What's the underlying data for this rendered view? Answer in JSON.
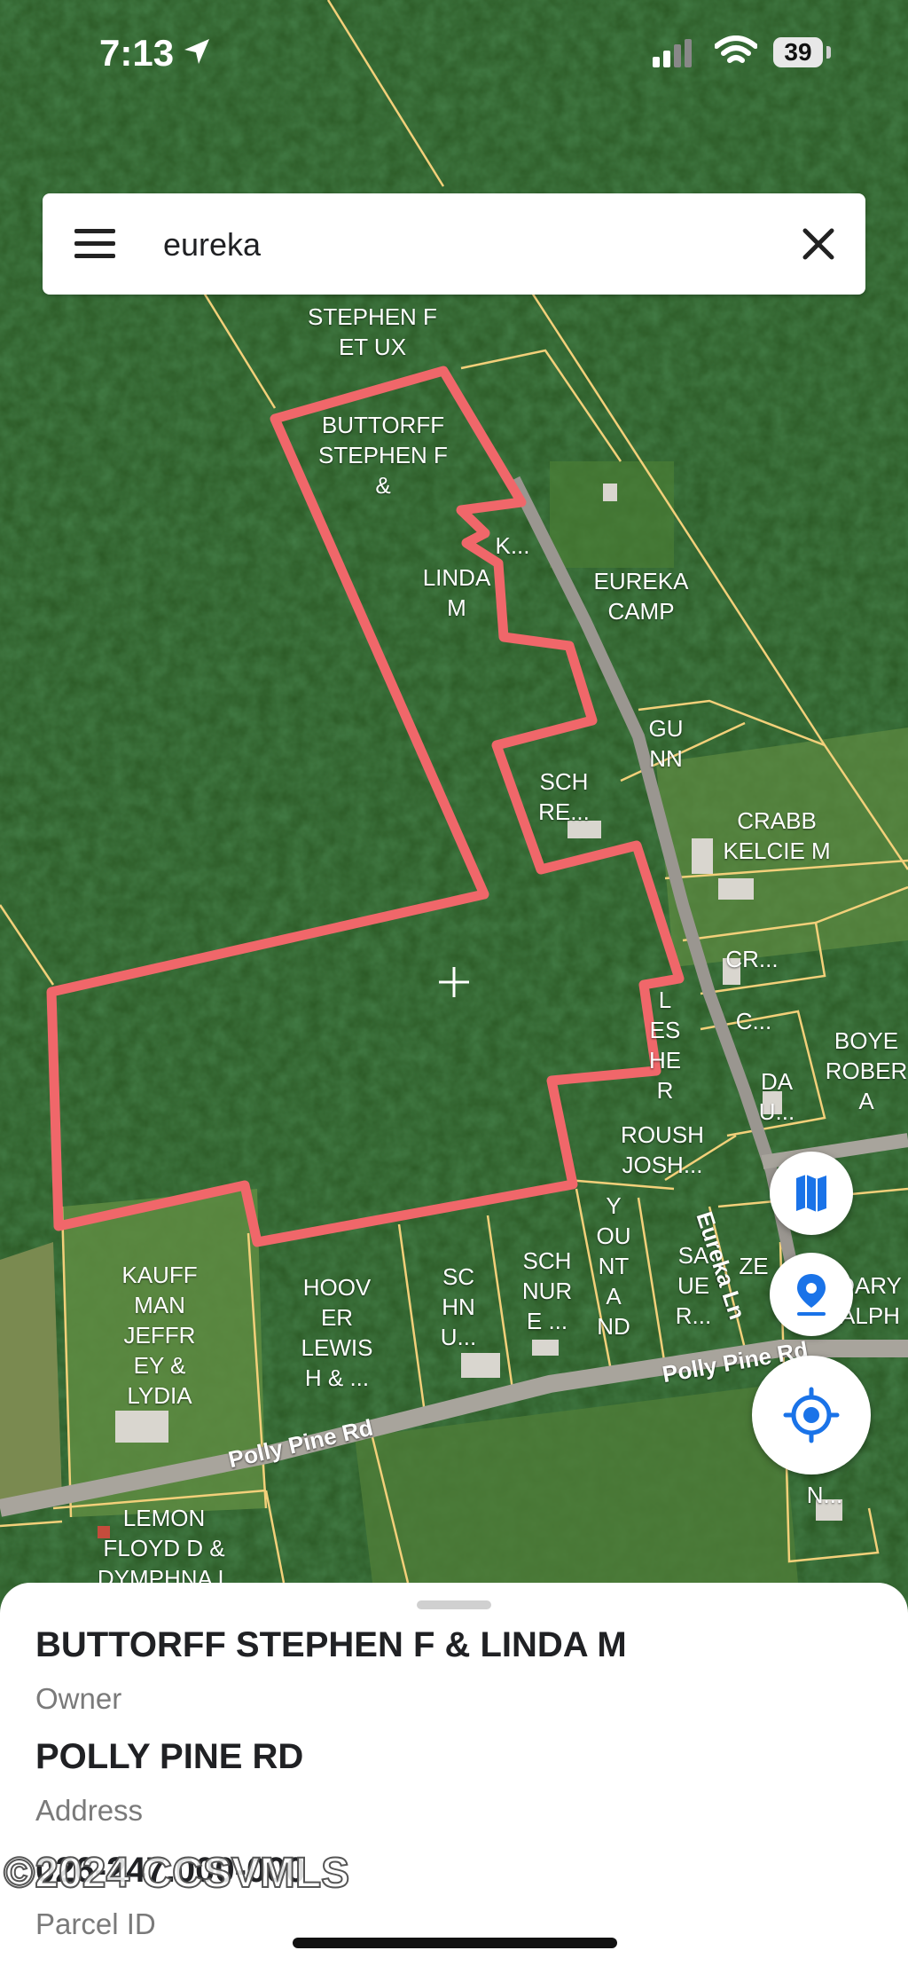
{
  "status_bar": {
    "time": "7:13",
    "battery": "39"
  },
  "search": {
    "query": "eureka"
  },
  "map": {
    "parcels": [
      {
        "id": "buttorff-top",
        "label": "STEPHEN F\nET UX"
      },
      {
        "id": "buttorff-main",
        "label": "BUTTORFF\nSTEPHEN F\n&"
      },
      {
        "id": "k",
        "label": "K..."
      },
      {
        "id": "linda",
        "label": "LINDA\nM"
      },
      {
        "id": "eureka-camp",
        "label": "EUREKA\nCAMP"
      },
      {
        "id": "gunn",
        "label": "GU\nNN"
      },
      {
        "id": "schre",
        "label": "SCH\nRE..."
      },
      {
        "id": "crabb",
        "label": "CRABB\nKELCIE M"
      },
      {
        "id": "cr",
        "label": "CR..."
      },
      {
        "id": "c",
        "label": "C..."
      },
      {
        "id": "lesher",
        "label": "L\nES\nHE\nR"
      },
      {
        "id": "boyer",
        "label": "BOYE\nROBER\nA"
      },
      {
        "id": "dau",
        "label": "DA\nU..."
      },
      {
        "id": "roush",
        "label": "ROUSH\nJOSH..."
      },
      {
        "id": "yountand",
        "label": "Y\nOU\nNT\nA\nND"
      },
      {
        "id": "sauer",
        "label": "SA\nUE\nR..."
      },
      {
        "id": "ze",
        "label": "ZE"
      },
      {
        "id": "dary",
        "label": "DARY\nALPH"
      },
      {
        "id": "kauffman",
        "label": "KAUFF\nMAN\nJEFFR\nEY &\nLYDIA"
      },
      {
        "id": "hoover",
        "label": "HOOV\nER\nLEWIS\nH & ..."
      },
      {
        "id": "schnu",
        "label": "SC\nHN\nU..."
      },
      {
        "id": "schnure",
        "label": "SCH\nNUR\nE ..."
      },
      {
        "id": "lemon",
        "label": "LEMON\nFLOYD D &\nDYMPHNA L"
      },
      {
        "id": "n",
        "label": "N..."
      }
    ],
    "roads": [
      {
        "id": "polly-pine-left",
        "label": "Polly Pine Rd"
      },
      {
        "id": "polly-pine-right",
        "label": "Polly Pine Rd"
      },
      {
        "id": "eureka-ln",
        "label": "Eureka Ln"
      }
    ],
    "controls": {
      "layers": "map-layers-icon",
      "pin": "location-pin-icon",
      "locate": "my-location-icon"
    },
    "highlight_color": "#f0676a",
    "line_color": "#f3d07a"
  },
  "parcel_info": {
    "owner": {
      "value": "BUTTORFF STEPHEN F & LINDA M",
      "label": "Owner"
    },
    "address": {
      "value": "POLLY PINE RD",
      "label": "Address"
    },
    "parcel_id": {
      "value": "026-247.000-000",
      "label": "Parcel ID"
    },
    "watermark": "©2024 CCSVMLS"
  }
}
